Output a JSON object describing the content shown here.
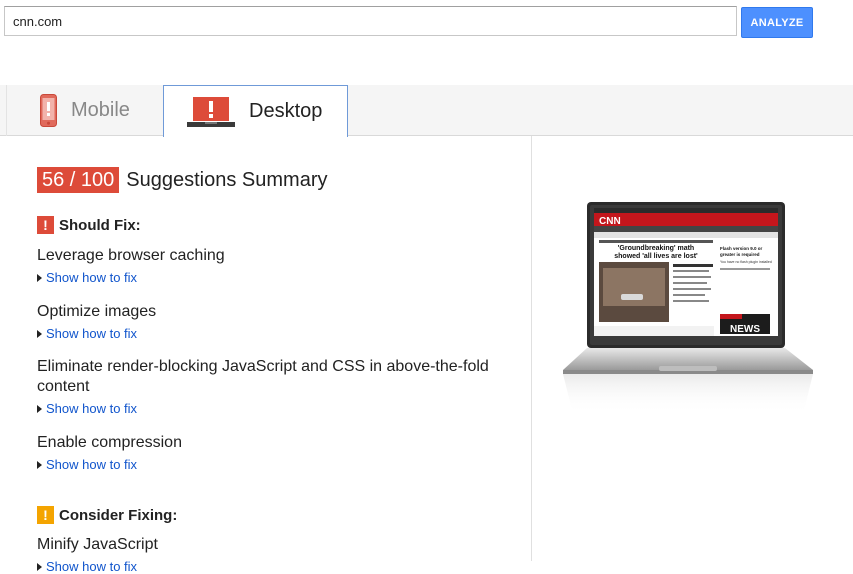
{
  "search": {
    "url_value": "cnn.com",
    "analyze_label": "ANALYZE"
  },
  "tabs": [
    {
      "label": "Mobile",
      "active": false,
      "icon": "phone-icon"
    },
    {
      "label": "Desktop",
      "active": true,
      "icon": "laptop-icon"
    }
  ],
  "summary": {
    "score": "56 / 100",
    "title": "Suggestions Summary"
  },
  "should_fix": {
    "label": "Should Fix:",
    "icon": "exclamation-icon",
    "color": "#dd4b39",
    "items": [
      {
        "title": "Leverage browser caching",
        "link": "Show how to fix"
      },
      {
        "title": "Optimize images",
        "link": "Show how to fix"
      },
      {
        "title": "Eliminate render-blocking JavaScript and CSS in above-the-fold content",
        "link": "Show how to fix"
      },
      {
        "title": "Enable compression",
        "link": "Show how to fix"
      }
    ]
  },
  "consider_fixing": {
    "label": "Consider Fixing:",
    "icon": "exclamation-icon",
    "color": "#f4a400",
    "items": [
      {
        "title": "Minify JavaScript",
        "link": "Show how to fix"
      }
    ]
  },
  "preview": {
    "icon": "laptop-screenshot",
    "logo": "CNN",
    "headline_line1": "'Groundbreaking' math",
    "headline_line2": "showed 'all lives are lost'",
    "side_line1": "Flash version 9.0 or",
    "side_line2": "greater is required",
    "side_line3": "You have no flash plugin installed",
    "promo": "NEWS"
  },
  "colors": {
    "accent_blue": "#4d90fe",
    "link_blue": "#1155cc",
    "score_red": "#dd4b39",
    "warn_orange": "#f4a400"
  }
}
